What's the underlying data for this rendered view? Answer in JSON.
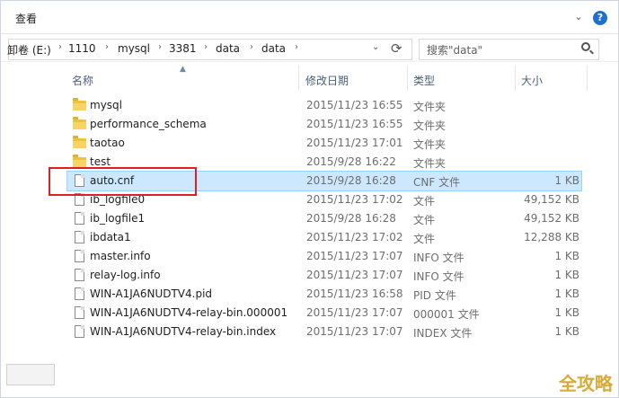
{
  "ribbon": {
    "title": "查看",
    "chevron": "⌄",
    "help": "?"
  },
  "address": {
    "crumbs": [
      "卸卷 (E:)",
      "1110",
      "mysql",
      "3381",
      "data",
      "data"
    ],
    "separator": "›",
    "dropdown": "⌄",
    "refresh": "⟳"
  },
  "search": {
    "placeholder": "搜索\"data\""
  },
  "columns": {
    "name": "名称",
    "date": "修改日期",
    "type": "类型",
    "size": "大小"
  },
  "files": [
    {
      "name": "mysql",
      "date": "2015/11/23 16:55",
      "type": "文件夹",
      "size": "",
      "icon": "folder-icon"
    },
    {
      "name": "performance_schema",
      "date": "2015/11/23 16:55",
      "type": "文件夹",
      "size": "",
      "icon": "folder-icon"
    },
    {
      "name": "taotao",
      "date": "2015/11/23 17:01",
      "type": "文件夹",
      "size": "",
      "icon": "folder-icon"
    },
    {
      "name": "test",
      "date": "2015/9/28 16:22",
      "type": "文件夹",
      "size": "",
      "icon": "folder-icon"
    },
    {
      "name": "auto.cnf",
      "date": "2015/9/28 16:28",
      "type": "CNF 文件",
      "size": "1 KB",
      "icon": "file-icon",
      "selected": true
    },
    {
      "name": "ib_logfile0",
      "date": "2015/11/23 17:02",
      "type": "文件",
      "size": "49,152 KB",
      "icon": "file-icon"
    },
    {
      "name": "ib_logfile1",
      "date": "2015/9/28 16:28",
      "type": "文件",
      "size": "49,152 KB",
      "icon": "file-icon"
    },
    {
      "name": "ibdata1",
      "date": "2015/11/23 17:02",
      "type": "文件",
      "size": "12,288 KB",
      "icon": "file-icon"
    },
    {
      "name": "master.info",
      "date": "2015/11/23 17:07",
      "type": "INFO 文件",
      "size": "1 KB",
      "icon": "file-icon"
    },
    {
      "name": "relay-log.info",
      "date": "2015/11/23 17:07",
      "type": "INFO 文件",
      "size": "1 KB",
      "icon": "file-icon"
    },
    {
      "name": "WIN-A1JA6NUDTV4.pid",
      "date": "2015/11/23 16:58",
      "type": "PID 文件",
      "size": "1 KB",
      "icon": "file-icon"
    },
    {
      "name": "WIN-A1JA6NUDTV4-relay-bin.000001",
      "date": "2015/11/23 17:07",
      "type": "000001 文件",
      "size": "1 KB",
      "icon": "file-icon"
    },
    {
      "name": "WIN-A1JA6NUDTV4-relay-bin.index",
      "date": "2015/11/23 17:07",
      "type": "INDEX 文件",
      "size": "1 KB",
      "icon": "file-icon"
    }
  ],
  "watermark": "全攻略",
  "colors": {
    "selection": "#cce8ff",
    "highlight_box": "#e02020",
    "folder": "#f0c040"
  }
}
